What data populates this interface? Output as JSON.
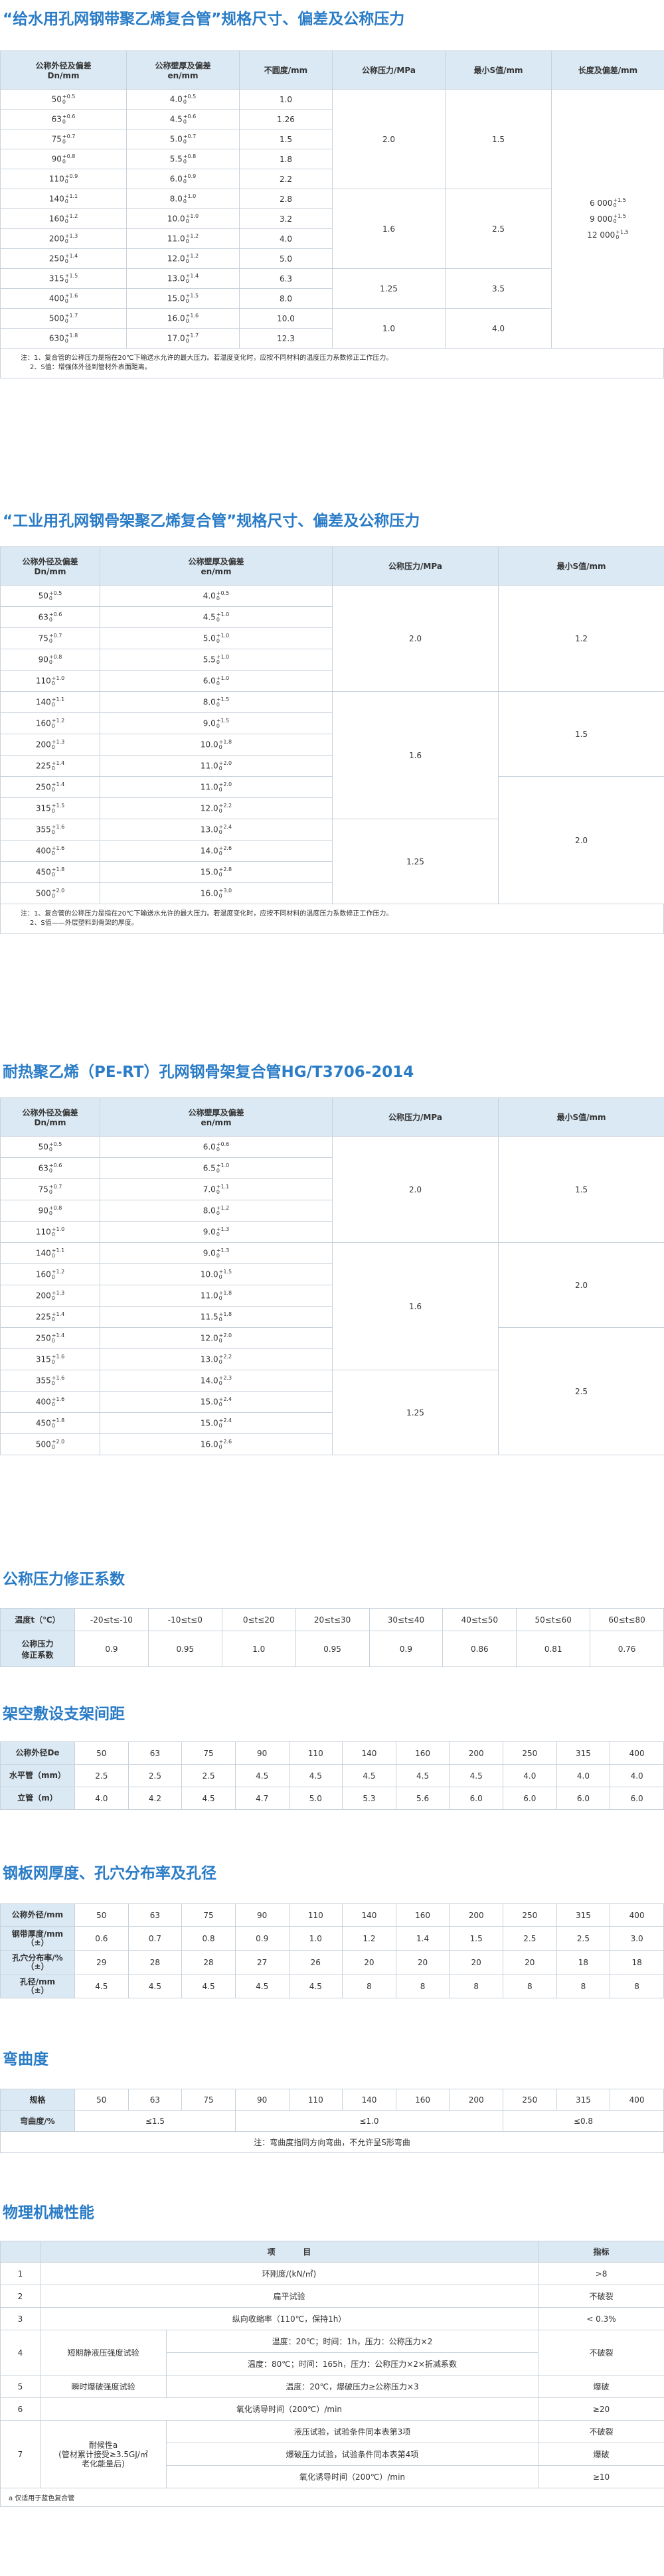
{
  "s1": {
    "title": "“给水用孔网钢带聚乙烯复合管”规格尺寸、偏差及公称压力",
    "headers": [
      "公称外径及偏差\nDn/mm",
      "公称壁厚及偏差\nen/mm",
      "不圆度/mm",
      "公称压力/MPa",
      "最小S值/mm",
      "长度及偏差/mm"
    ],
    "rows": [
      {
        "od": "50",
        "odt": "+0.5",
        "wt": "4.0",
        "wtt": "+0.5",
        "ov": "1.0"
      },
      {
        "od": "63",
        "odt": "+0.6",
        "wt": "4.5",
        "wtt": "+0.6",
        "ov": "1.26"
      },
      {
        "od": "75",
        "odt": "+0.7",
        "wt": "5.0",
        "wtt": "+0.7",
        "ov": "1.5"
      },
      {
        "od": "90",
        "odt": "+0.8",
        "wt": "5.5",
        "wtt": "+0.8",
        "ov": "1.8"
      },
      {
        "od": "110",
        "odt": "+0.9",
        "wt": "6.0",
        "wtt": "+0.9",
        "ov": "2.2"
      },
      {
        "od": "140",
        "odt": "+1.1",
        "wt": "8.0",
        "wtt": "+1.0",
        "ov": "2.8"
      },
      {
        "od": "160",
        "odt": "+1.2",
        "wt": "10.0",
        "wtt": "+1.0",
        "ov": "3.2"
      },
      {
        "od": "200",
        "odt": "+1.3",
        "wt": "11.0",
        "wtt": "+1.2",
        "ov": "4.0"
      },
      {
        "od": "250",
        "odt": "+1.4",
        "wt": "12.0",
        "wtt": "+1.2",
        "ov": "5.0"
      },
      {
        "od": "315",
        "odt": "+1.5",
        "wt": "13.0",
        "wtt": "+1.4",
        "ov": "6.3"
      },
      {
        "od": "400",
        "odt": "+1.6",
        "wt": "15.0",
        "wtt": "+1.5",
        "ov": "8.0"
      },
      {
        "od": "500",
        "odt": "+1.7",
        "wt": "16.0",
        "wtt": "+1.6",
        "ov": "10.0"
      },
      {
        "od": "630",
        "odt": "+1.8",
        "wt": "17.0",
        "wtt": "+1.7",
        "ov": "12.3"
      }
    ],
    "pressure": [
      "2.0",
      "1.6",
      "1.25",
      "1.0"
    ],
    "minS": [
      "1.5",
      "2.5",
      "3.5",
      "4.0"
    ],
    "lengths": [
      {
        "v": "6 000",
        "t": "+1.5",
        "b": "0"
      },
      {
        "v": "9 000",
        "t": "+1.5",
        "b": "0"
      },
      {
        "v": "12 000",
        "t": "+1.5",
        "b": "0"
      }
    ],
    "notes": [
      "注：1、复合管的公称压力是指在20℃下输送水允许的最大压力。若温度变化时，应按不同材料的温度压力系数修正工作压力。",
      "2、S值：增强体外径到管材外表面距离。"
    ]
  },
  "s2": {
    "title": "“工业用孔网钢骨架聚乙烯复合管”规格尺寸、偏差及公称压力",
    "headers": [
      "公称外径及偏差\nDn/mm",
      "公称壁厚及偏差\nen/mm",
      "公称压力/MPa",
      "最小S值/mm"
    ],
    "rows": [
      {
        "od": "50",
        "odt": "+0.5",
        "wt": "4.0",
        "wtt": "+0.5"
      },
      {
        "od": "63",
        "odt": "+0.6",
        "wt": "4.5",
        "wtt": "+1.0"
      },
      {
        "od": "75",
        "odt": "+0.7",
        "wt": "5.0",
        "wtt": "+1.0"
      },
      {
        "od": "90",
        "odt": "+0.8",
        "wt": "5.5",
        "wtt": "+1.0"
      },
      {
        "od": "110",
        "odt": "+1.0",
        "wt": "6.0",
        "wtt": "+1.0"
      },
      {
        "od": "140",
        "odt": "+1.1",
        "wt": "8.0",
        "wtt": "+1.5"
      },
      {
        "od": "160",
        "odt": "+1.2",
        "wt": "9.0",
        "wtt": "+1.5"
      },
      {
        "od": "200",
        "odt": "+1.3",
        "wt": "10.0",
        "wtt": "+1.8"
      },
      {
        "od": "225",
        "odt": "+1.4",
        "wt": "11.0",
        "wtt": "+2.0"
      },
      {
        "od": "250",
        "odt": "+1.4",
        "wt": "11.0",
        "wtt": "+2.0"
      },
      {
        "od": "315",
        "odt": "+1.5",
        "wt": "12.0",
        "wtt": "+2.2"
      },
      {
        "od": "355",
        "odt": "+1.6",
        "wt": "13.0",
        "wtt": "+2.4"
      },
      {
        "od": "400",
        "odt": "+1.6",
        "wt": "14.0",
        "wtt": "+2.6"
      },
      {
        "od": "450",
        "odt": "+1.8",
        "wt": "15.0",
        "wtt": "+2.8"
      },
      {
        "od": "500",
        "odt": "+2.0",
        "wt": "16.0",
        "wtt": "+3.0"
      }
    ],
    "pressure": [
      "2.0",
      "1.6",
      "1.25"
    ],
    "minS": [
      "1.2",
      "1.5",
      "2.0"
    ],
    "notes": [
      "注：1、复合管的公称压力是指在20℃下输送水允许的最大压力。若温度变化时，应按不同材料的温度压力系数修正工作压力。",
      "2、S值——外层塑料到骨架的厚度。"
    ]
  },
  "s3": {
    "title": "耐热聚乙烯（PE-RT）孔网钢骨架复合管HG/T3706-2014",
    "headers": [
      "公称外径及偏差\nDn/mm",
      "公称壁厚及偏差\nen/mm",
      "公称压力/MPa",
      "最小S值/mm"
    ],
    "rows": [
      {
        "od": "50",
        "odt": "+0.5",
        "wt": "6.0",
        "wtt": "+0.6"
      },
      {
        "od": "63",
        "odt": "+0.6",
        "wt": "6.5",
        "wtt": "+1.0"
      },
      {
        "od": "75",
        "odt": "+0.7",
        "wt": "7.0",
        "wtt": "+1.1"
      },
      {
        "od": "90",
        "odt": "+0.8",
        "wt": "8.0",
        "wtt": "+1.2"
      },
      {
        "od": "110",
        "odt": "+1.0",
        "wt": "9.0",
        "wtt": "+1.3"
      },
      {
        "od": "140",
        "odt": "+1.1",
        "wt": "9.0",
        "wtt": "+1.3"
      },
      {
        "od": "160",
        "odt": "+1.2",
        "wt": "10.0",
        "wtt": "+1.5"
      },
      {
        "od": "200",
        "odt": "+1.3",
        "wt": "11.0",
        "wtt": "+1.8"
      },
      {
        "od": "225",
        "odt": "+1.4",
        "wt": "11.5",
        "wtt": "+1.8"
      },
      {
        "od": "250",
        "odt": "+1.4",
        "wt": "12.0",
        "wtt": "+2.0"
      },
      {
        "od": "315",
        "odt": "+1.6",
        "wt": "13.0",
        "wtt": "+2.2"
      },
      {
        "od": "355",
        "odt": "+1.6",
        "wt": "14.0",
        "wtt": "+2.3"
      },
      {
        "od": "400",
        "odt": "+1.6",
        "wt": "15.0",
        "wtt": "+2.4"
      },
      {
        "od": "450",
        "odt": "+1.8",
        "wt": "15.0",
        "wtt": "+2.4"
      },
      {
        "od": "500",
        "odt": "+2.0",
        "wt": "16.0",
        "wtt": "+2.6"
      }
    ],
    "pressure": [
      "2.0",
      "1.6",
      "1.25"
    ],
    "minS": [
      "1.5",
      "2.0",
      "2.5"
    ]
  },
  "s4": {
    "title": "公称压力修正系数",
    "label1": "温度t（℃）",
    "label2": "公称压力\n修正系数",
    "temps": [
      "-20≤t≤-10",
      "-10≤t≤0",
      "0≤t≤20",
      "20≤t≤30",
      "30≤t≤40",
      "40≤t≤50",
      "50≤t≤60",
      "60≤t≤80"
    ],
    "coefs": [
      "0.9",
      "0.95",
      "1.0",
      "0.95",
      "0.9",
      "0.86",
      "0.81",
      "0.76"
    ]
  },
  "s5": {
    "title": "架空敷设支架间距",
    "rows": [
      {
        "label": "公称外径De",
        "vals": [
          "50",
          "63",
          "75",
          "90",
          "110",
          "140",
          "160",
          "200",
          "250",
          "315",
          "400"
        ]
      },
      {
        "label": "水平管（mm）",
        "vals": [
          "2.5",
          "2.5",
          "2.5",
          "4.5",
          "4.5",
          "4.5",
          "4.5",
          "4.5",
          "4.0",
          "4.0",
          "4.0"
        ]
      },
      {
        "label": "立管（m）",
        "vals": [
          "4.0",
          "4.2",
          "4.5",
          "4.7",
          "5.0",
          "5.3",
          "5.6",
          "6.0",
          "6.0",
          "6.0",
          "6.0"
        ]
      }
    ]
  },
  "s6": {
    "title": "钢板网厚度、孔穴分布率及孔径",
    "rows": [
      {
        "label": "公称外径/mm",
        "vals": [
          "50",
          "63",
          "75",
          "90",
          "110",
          "140",
          "160",
          "200",
          "250",
          "315",
          "400"
        ]
      },
      {
        "label": "钢带厚度/mm\n（±）",
        "vals": [
          "0.6",
          "0.7",
          "0.8",
          "0.9",
          "1.0",
          "1.2",
          "1.4",
          "1.5",
          "2.5",
          "2.5",
          "3.0"
        ]
      },
      {
        "label": "孔穴分布率/%\n（±）",
        "vals": [
          "29",
          "28",
          "28",
          "27",
          "26",
          "20",
          "20",
          "20",
          "20",
          "18",
          "18"
        ]
      },
      {
        "label": "孔径/mm\n（±）",
        "vals": [
          "4.5",
          "4.5",
          "4.5",
          "4.5",
          "4.5",
          "8",
          "8",
          "8",
          "8",
          "8",
          "8"
        ]
      }
    ]
  },
  "s7": {
    "title": "弯曲度",
    "spec_label": "规格",
    "specs": [
      "50",
      "63",
      "75",
      "90",
      "110",
      "140",
      "160",
      "200",
      "250",
      "315",
      "400"
    ],
    "bend_label": "弯曲度/%",
    "bend": [
      "≤1.5",
      "≤1.0",
      "≤0.8"
    ],
    "note": "注：弯曲度指同方向弯曲，不允许呈S形弯曲"
  },
  "s8": {
    "title": "物理机械性能",
    "head_item": "项          目",
    "head_index": "指标",
    "r1": {
      "n": "1",
      "item": "环刚度/(kN/㎡)",
      "val": ">8"
    },
    "r2": {
      "n": "2",
      "item": "扁平试验",
      "val": "不破裂"
    },
    "r3": {
      "n": "3",
      "item": "纵向收缩率（110℃，保持1h）",
      "val": "< 0.3%"
    },
    "r4": {
      "n": "4",
      "item": "短期静液压强度试验",
      "c1": "温度：20℃；时间：1h，压力：公称压力×2",
      "c2": "温度：80℃；时间：165h，压力：公称压力×2×折减系数",
      "val": "不破裂"
    },
    "r5": {
      "n": "5",
      "item": "瞬时爆破强度试验",
      "c1": "温度：20℃，爆破压力≥公称压力×3",
      "val": "爆破"
    },
    "r6": {
      "n": "6",
      "item": "氧化诱导时间（200℃）/min",
      "val": "≥20"
    },
    "r7": {
      "n": "7",
      "item": "耐候性a\n(管材累计接受≥3.5GJ/㎡\n老化能量后)",
      "c1": "液压试验，试验条件同本表第3项",
      "c2": "爆破压力试验，试验条件同本表第4项",
      "c3": "氧化诱导时间（200℃）/min",
      "v1": "不破裂",
      "v2": "爆破",
      "v3": "≥10"
    },
    "note": "a  仅适用于蓝色复合管"
  }
}
